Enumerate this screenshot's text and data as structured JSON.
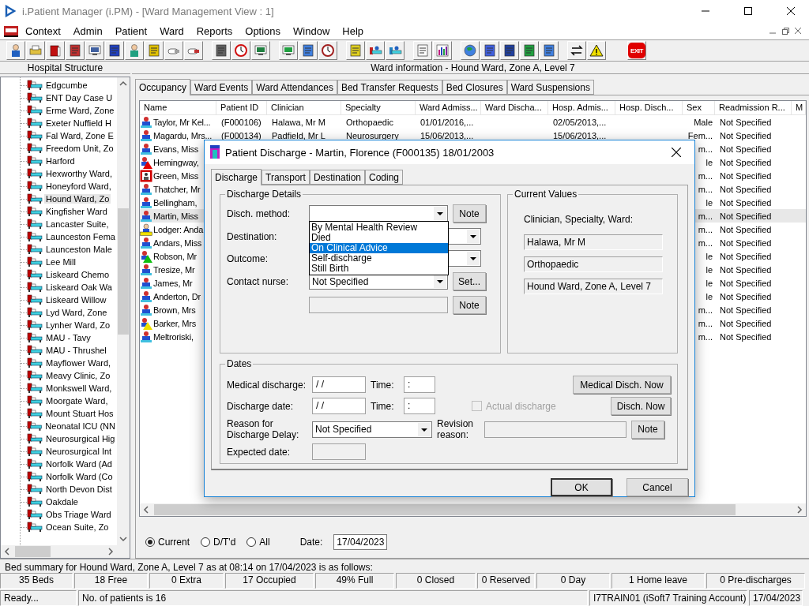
{
  "window": {
    "title": "i.Patient Manager (i.PM) - [Ward Management View : 1]"
  },
  "menu": [
    "Context",
    "Admin",
    "Patient",
    "Ward",
    "Reports",
    "Options",
    "Window",
    "Help"
  ],
  "toolbar": {
    "exit_label": "EXIT"
  },
  "hospital_structure": {
    "title": "Hospital Structure",
    "items": [
      {
        "label": "Edgcumbe",
        "selected": false
      },
      {
        "label": "ENT Day Case U",
        "selected": false
      },
      {
        "label": "Erme Ward, Zone",
        "selected": false
      },
      {
        "label": "Exeter Nuffield H",
        "selected": false
      },
      {
        "label": "Fal Ward, Zone E",
        "selected": false
      },
      {
        "label": "Freedom Unit, Zo",
        "selected": false
      },
      {
        "label": "Harford",
        "selected": false
      },
      {
        "label": "Hexworthy Ward,",
        "selected": false
      },
      {
        "label": "Honeyford Ward,",
        "selected": false
      },
      {
        "label": "Hound Ward, Zo",
        "selected": true
      },
      {
        "label": "Kingfisher Ward",
        "selected": false
      },
      {
        "label": "Lancaster Suite,",
        "selected": false
      },
      {
        "label": "Launceston Fema",
        "selected": false
      },
      {
        "label": "Launceston Male",
        "selected": false
      },
      {
        "label": "Lee Mill",
        "selected": false
      },
      {
        "label": "Liskeard Chemo",
        "selected": false
      },
      {
        "label": "Liskeard Oak Wa",
        "selected": false
      },
      {
        "label": "Liskeard Willow",
        "selected": false
      },
      {
        "label": "Lyd Ward, Zone",
        "selected": false
      },
      {
        "label": "Lynher Ward, Zo",
        "selected": false
      },
      {
        "label": "MAU - Tavy",
        "selected": false
      },
      {
        "label": "MAU - Thrushel",
        "selected": false
      },
      {
        "label": "Mayflower Ward,",
        "selected": false
      },
      {
        "label": "Meavy Clinic, Zo",
        "selected": false
      },
      {
        "label": "Monkswell Ward,",
        "selected": false
      },
      {
        "label": "Moorgate Ward,",
        "selected": false
      },
      {
        "label": "Mount Stuart Hos",
        "selected": false
      },
      {
        "label": "Neonatal ICU (NN",
        "selected": false
      },
      {
        "label": "Neurosurgical Hig",
        "selected": false
      },
      {
        "label": "Neurosurgical Int",
        "selected": false
      },
      {
        "label": "Norfolk Ward (Ad",
        "selected": false
      },
      {
        "label": "Norfolk Ward (Co",
        "selected": false
      },
      {
        "label": "North Devon Dist",
        "selected": false
      },
      {
        "label": "Oakdale",
        "selected": false
      },
      {
        "label": "Obs Triage Ward",
        "selected": false
      },
      {
        "label": "Ocean Suite, Zo",
        "selected": false
      }
    ]
  },
  "ward_info": {
    "title": "Ward information - Hound Ward, Zone A, Level 7",
    "tabs": [
      {
        "label": "Occupancy",
        "selected": true
      },
      {
        "label": "Ward Events",
        "selected": false
      },
      {
        "label": "Ward Attendances",
        "selected": false
      },
      {
        "label": "Bed Transfer Requests",
        "selected": false
      },
      {
        "label": "Bed Closures",
        "selected": false
      },
      {
        "label": "Ward Suspensions",
        "selected": false
      }
    ],
    "table": {
      "columns": [
        "Name",
        "Patient ID",
        "Clinician",
        "Specialty",
        "Ward Admiss...",
        "Ward Discha...",
        "Hosp. Admis...",
        "Hosp. Disch...",
        "Sex",
        "Readmission R...",
        "M"
      ],
      "rows": [
        {
          "kind": "patient",
          "selected": false,
          "name": "Taylor, Mr Kel...",
          "patient_id": "(F000106)",
          "clinician": "Halawa, Mr M",
          "specialty": "Orthopaedic",
          "ward_admission": "01/01/2016,...",
          "hosp_admission": "02/05/2013,...",
          "sex": "Male",
          "readmission": "Not Specified"
        },
        {
          "kind": "patient",
          "selected": false,
          "name": "Magardu, Mrs...",
          "patient_id": "(F000134)",
          "clinician": "Padfield, Mr L",
          "specialty": "Neurosurgery",
          "ward_admission": "15/06/2013,...",
          "hosp_admission": "15/06/2013,...",
          "sex": "Fem...",
          "readmission": "Not Specified"
        },
        {
          "kind": "patient",
          "selected": false,
          "name": "Evans, Miss",
          "sex": "m...",
          "readmission": "Not Specified"
        },
        {
          "kind": "alert",
          "color": "#e00000",
          "selected": false,
          "name": "Hemingway,",
          "sex": "le",
          "readmission": "Not Specified"
        },
        {
          "kind": "blocked",
          "selected": false,
          "name": "Green, Miss",
          "sex": "m...",
          "readmission": "Not Specified"
        },
        {
          "kind": "patient",
          "selected": false,
          "name": "Thatcher, Mr",
          "sex": "m...",
          "readmission": "Not Specified"
        },
        {
          "kind": "patient",
          "selected": false,
          "name": "Bellingham,",
          "sex": "le",
          "readmission": "Not Specified"
        },
        {
          "kind": "patient",
          "selected": true,
          "name": "Martin, Miss",
          "sex": "m...",
          "readmission": "Not Specified"
        },
        {
          "kind": "lodger",
          "selected": false,
          "name": "Lodger: Anda",
          "sex": "m...",
          "readmission": "Not Specified"
        },
        {
          "kind": "patient",
          "selected": false,
          "name": "Andars, Miss",
          "sex": "m...",
          "readmission": "Not Specified"
        },
        {
          "kind": "alert",
          "color": "#10c010",
          "selected": false,
          "name": "Robson, Mr",
          "sex": "le",
          "readmission": "Not Specified"
        },
        {
          "kind": "patient",
          "selected": false,
          "name": "Tresize, Mr",
          "sex": "le",
          "readmission": "Not Specified"
        },
        {
          "kind": "patient",
          "selected": false,
          "name": "James, Mr",
          "sex": "le",
          "readmission": "Not Specified"
        },
        {
          "kind": "patient",
          "selected": false,
          "name": "Anderton, Dr",
          "sex": "le",
          "readmission": "Not Specified"
        },
        {
          "kind": "patient",
          "selected": false,
          "name": "Brown, Mrs",
          "sex": "m...",
          "readmission": "Not Specified"
        },
        {
          "kind": "alert",
          "color": "#f0e000",
          "selected": false,
          "name": "Barker, Mrs",
          "sex": "m...",
          "readmission": "Not Specified"
        },
        {
          "kind": "patient",
          "selected": false,
          "name": "Meltroriski,",
          "sex": "m...",
          "readmission": "Not Specified"
        }
      ]
    },
    "filters": [
      {
        "label": "Current",
        "selected": true
      },
      {
        "label": "D/T'd",
        "selected": false
      },
      {
        "label": "All",
        "selected": false
      }
    ],
    "date": {
      "label": "Date:",
      "value": "17/04/2023"
    }
  },
  "bed_summary": {
    "text": "Bed summary for Hound Ward, Zone A, Level 7 as at 08:14 on 17/04/2023 is as follows:",
    "counts": [
      "35 Beds",
      "18 Free",
      "0 Extra",
      "17 Occupied",
      "49% Full",
      "0 Closed",
      "0 Reserved",
      "0 Day",
      "1 Home leave",
      "0 Pre-discharges"
    ]
  },
  "status_bar": [
    "Ready...",
    "No. of patients is 16",
    "I7TRAIN01 (iSoft7 Training Account)",
    "17/04/2023"
  ],
  "dialog": {
    "title": "Patient Discharge - Martin, Florence (F000135) 18/01/2003",
    "tabs": [
      {
        "label": "Discharge",
        "selected": true
      },
      {
        "label": "Transport",
        "selected": false
      },
      {
        "label": "Destination",
        "selected": false
      },
      {
        "label": "Coding",
        "selected": false
      }
    ],
    "discharge_details": {
      "title": "Discharge Details",
      "disch_method": {
        "label": "Disch. method:",
        "button": "Note",
        "options": [
          {
            "label": "By Mental Health Review",
            "selected": false
          },
          {
            "label": "Died",
            "selected": false
          },
          {
            "label": "On Clinical Advice",
            "selected": true
          },
          {
            "label": "Self-discharge",
            "selected": false
          },
          {
            "label": "Still Birth",
            "selected": false
          }
        ]
      },
      "destination": {
        "label": "Destination:"
      },
      "outcome": {
        "label": "Outcome:"
      },
      "contact_nurse": {
        "label": "Contact nurse:",
        "value": "Not Specified",
        "button": "Set..."
      },
      "note_button": "Note"
    },
    "current_values": {
      "title": "Current Values",
      "caption": "Clinician, Specialty, Ward:",
      "values": [
        "Halawa, Mr M",
        "Orthopaedic",
        "Hound Ward, Zone A, Level 7"
      ]
    },
    "dates": {
      "title": "Dates",
      "medical_discharge": {
        "label": "Medical discharge:",
        "value": "/ /",
        "time_label": "Time:",
        "time": ":",
        "button": "Medical Disch. Now"
      },
      "discharge_date": {
        "label": "Discharge date:",
        "value": "/ /",
        "time_label": "Time:",
        "time": ":",
        "button": "Disch. Now"
      },
      "actual_discharge": {
        "label": "Actual discharge",
        "checked": false,
        "disabled": true
      },
      "reason": {
        "label": "Reason for Discharge Delay:",
        "value": "Not Specified"
      },
      "revision": {
        "label": "Revision reason:",
        "button": "Note"
      },
      "expected": {
        "label": "Expected date:"
      }
    },
    "buttons": [
      "OK",
      "Cancel"
    ]
  }
}
